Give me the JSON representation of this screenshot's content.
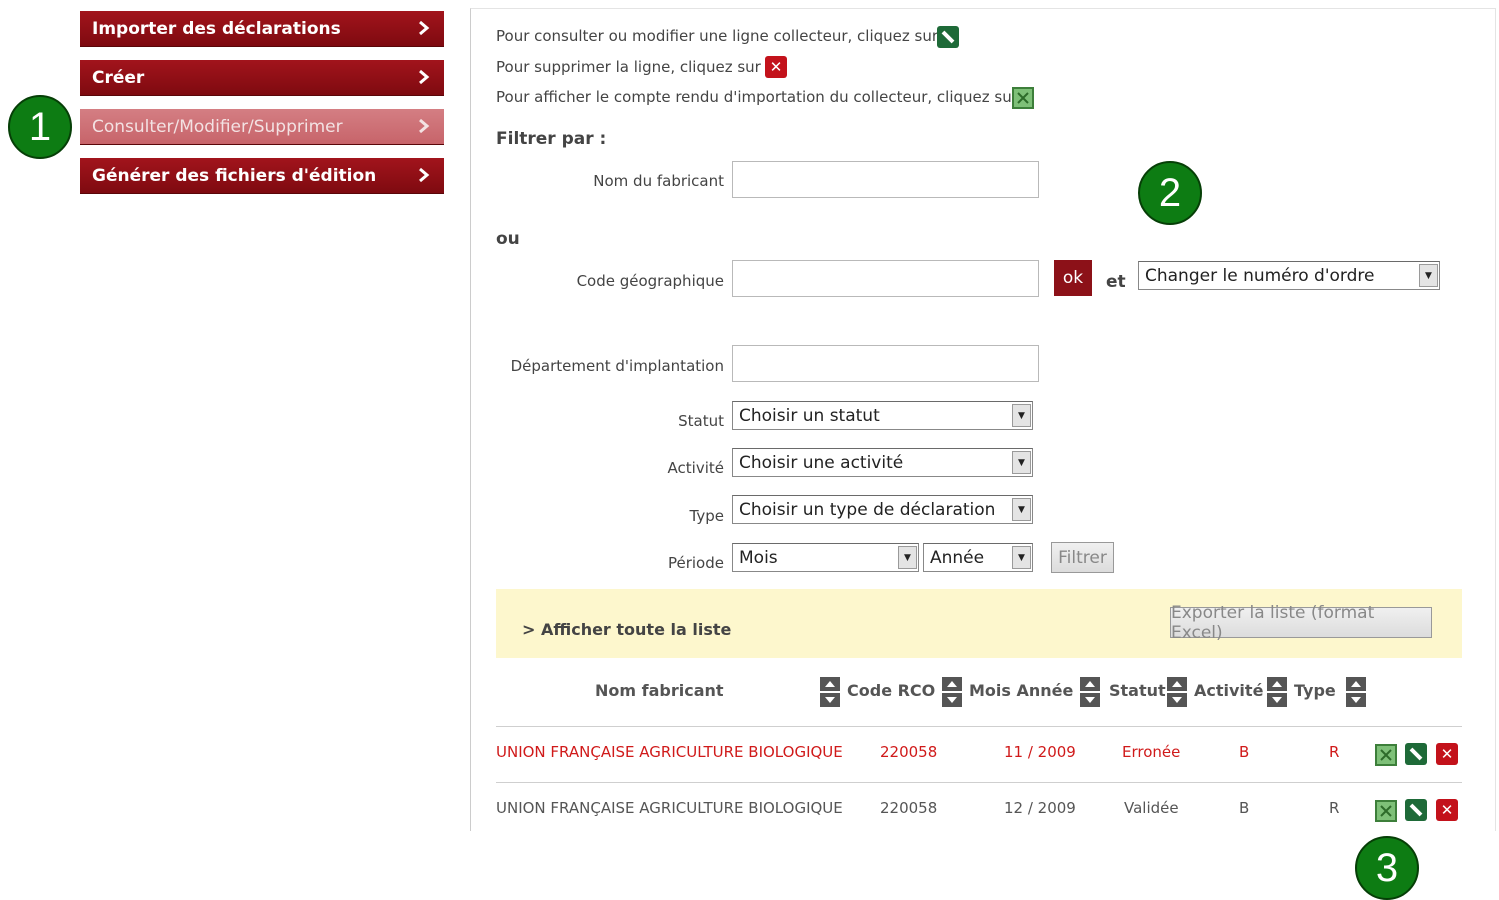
{
  "menu": {
    "items": [
      {
        "label": "Importer des déclarations"
      },
      {
        "label": "Créer"
      },
      {
        "label": "Consulter/Modifier/Supprimer"
      },
      {
        "label": "Générer des fichiers d'édition"
      }
    ]
  },
  "badges": [
    "1",
    "2",
    "3"
  ],
  "instructions": {
    "edit": "Pour consulter ou modifier une ligne collecteur, cliquez sur",
    "delete": "Pour supprimer la ligne, cliquez sur",
    "report": "Pour afficher le compte rendu d'importation du collecteur, cliquez sur"
  },
  "filter": {
    "title": "Filtrer par :",
    "nom_label": "Nom du fabricant",
    "ou": "ou",
    "code_label": "Code géographique",
    "ok": "ok",
    "et": "et",
    "order_select": "Changer le numéro d'ordre",
    "dept_label": "Département d'implantation",
    "statut_label": "Statut",
    "statut_select": "Choisir un statut",
    "activite_label": "Activité",
    "activite_select": "Choisir une activité",
    "type_label": "Type",
    "type_select": "Choisir un type de déclaration",
    "periode_label": "Période",
    "mois_select": "Mois",
    "annee_select": "Année",
    "filtrer": "Filtrer"
  },
  "list": {
    "show_all": "> Afficher toute la liste",
    "export": "Exporter la liste (format Excel)",
    "headers": [
      "Nom fabricant",
      "Code RCO",
      "Mois Année",
      "Statut",
      "Activité",
      "Type"
    ],
    "rows": [
      {
        "nom": "UNION FRANÇAISE AGRICULTURE BIOLOGIQUE",
        "code": "220058",
        "mois": "11 / 2009",
        "statut": "Erronée",
        "activite": "B",
        "type": "R",
        "color": "#d01a1a"
      },
      {
        "nom": "UNION FRANÇAISE AGRICULTURE BIOLOGIQUE",
        "code": "220058",
        "mois": "12 / 2009",
        "statut": "Validée",
        "activite": "B",
        "type": "R",
        "color": "#555555"
      }
    ]
  },
  "colors": {
    "brand": "#8c1118",
    "active": "#c7646a",
    "badge": "#0d7c13",
    "highlight": "#fdf7cd"
  }
}
